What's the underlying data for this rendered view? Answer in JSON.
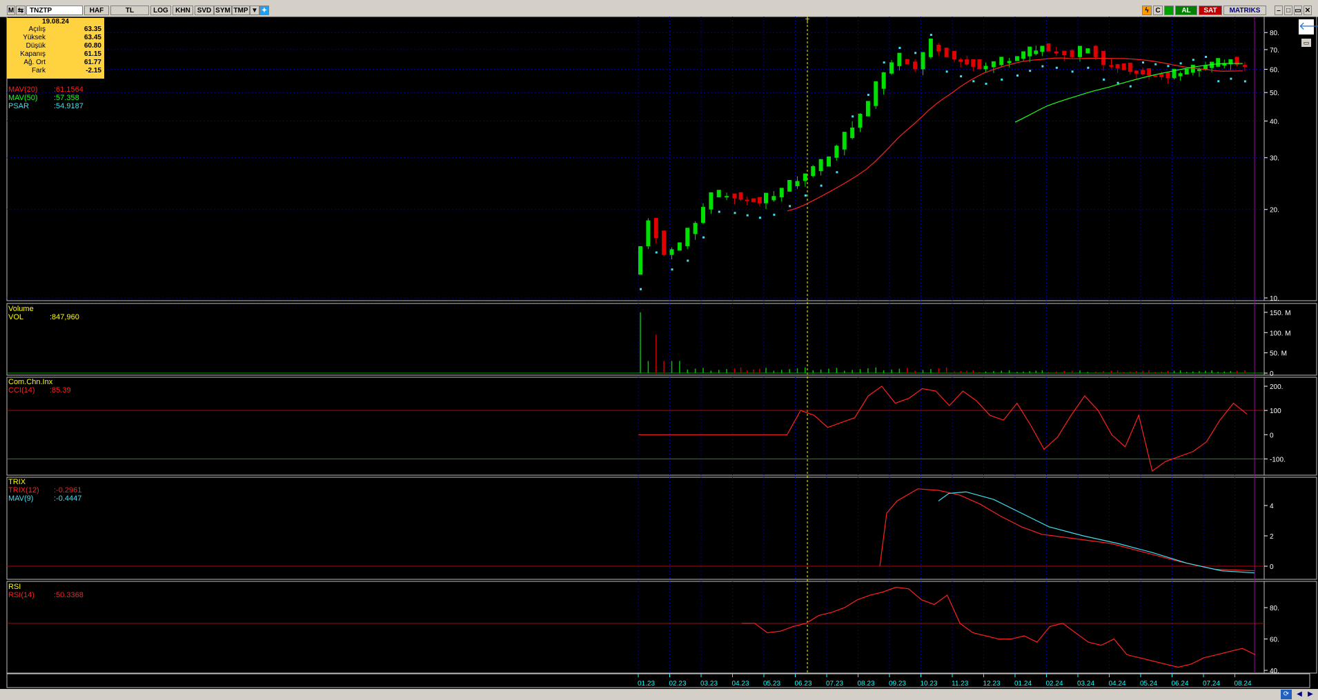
{
  "toolbar": {
    "symbol": "TNZTP",
    "buttons": [
      "HAF",
      "TL",
      "LOG",
      "KHN",
      "SVD",
      "SYM",
      "TMP"
    ],
    "buy_label": "AL",
    "sell_label": "SAT",
    "brand": "MATRIKS"
  },
  "info_box": {
    "date": "19.08.24",
    "rows": [
      {
        "label": "Açılış",
        "value": "63.35"
      },
      {
        "label": "Yüksek",
        "value": "63.45"
      },
      {
        "label": "Düşük",
        "value": "60.80"
      },
      {
        "label": "Kapanış",
        "value": "61.15"
      },
      {
        "label": "Ağ. Ort",
        "value": "61.77"
      },
      {
        "label": "Fark",
        "value": "-2.15"
      }
    ]
  },
  "price_panel": {
    "legend": [
      {
        "name": "MAV(20)",
        "value": ":61.1564",
        "color": "#ff2020"
      },
      {
        "name": "MAV(50)",
        "value": ":57.358",
        "color": "#20ff20"
      },
      {
        "name": "PSAR",
        "value": ":54.9187",
        "color": "#40e0f0"
      }
    ],
    "y_ticks": [
      "80.",
      "70.",
      "60.",
      "50.",
      "40.",
      "30.",
      "20.",
      "10."
    ]
  },
  "volume_panel": {
    "title": "Volume",
    "legend": [
      {
        "name": "VOL",
        "value": ":847,960",
        "color": "#ffff00"
      }
    ],
    "y_ticks": [
      "150. M",
      "100. M",
      "50. M",
      "0"
    ]
  },
  "cci_panel": {
    "title": "Com.Chn.Inx",
    "legend": [
      {
        "name": "CCI(14)",
        "value": ":85.39",
        "color": "#ff2020"
      }
    ],
    "y_ticks": [
      "200.",
      "100",
      "0",
      "-100."
    ]
  },
  "trix_panel": {
    "title": "TRIX",
    "legend": [
      {
        "name": "TRIX(12)",
        "value": ":-0.2961",
        "color": "#ff2020"
      },
      {
        "name": "MAV(9)",
        "value": ":-0.4447",
        "color": "#40e0f0"
      }
    ],
    "y_ticks": [
      "4",
      "2",
      "0"
    ]
  },
  "rsi_panel": {
    "title": "RSI",
    "legend": [
      {
        "name": "RSI(14)",
        "value": ":50.3368",
        "color": "#ff2020"
      }
    ],
    "y_ticks": [
      "80.",
      "60.",
      "40."
    ]
  },
  "x_axis": {
    "labels": [
      "01.23",
      "02.23",
      "03.23",
      "04.23",
      "05.23",
      "06.23",
      "07.23",
      "08.23",
      "09.23",
      "10.23",
      "11.23",
      "12.23",
      "01.24",
      "02.24",
      "03.24",
      "04.24",
      "05.24",
      "06.24",
      "07.24",
      "08.24"
    ]
  },
  "cursor_marker": "T",
  "colors": {
    "up": "#00e000",
    "down": "#e00000",
    "grid": "#0000a0",
    "axis_text": "#ffffff",
    "date_text": "#00ffff",
    "info_bg": "#ffd23f"
  },
  "chart_data": {
    "type": "line",
    "title": "TNZTP",
    "price": {
      "log_scale": true,
      "ylim": [
        10,
        85
      ],
      "mav20_last": 61.1564,
      "mav50_last": 57.358,
      "psar_last": 54.9187,
      "close_path": [
        [
          "01.23",
          12
        ],
        [
          "01.23",
          18
        ],
        [
          "02.23",
          14
        ],
        [
          "02.23",
          15
        ],
        [
          "03.23",
          18
        ],
        [
          "03.23",
          22
        ],
        [
          "04.23",
          22
        ],
        [
          "05.23",
          21
        ],
        [
          "05.23",
          22
        ],
        [
          "06.23",
          24
        ],
        [
          "06.23",
          26
        ],
        [
          "07.23",
          28
        ],
        [
          "07.23",
          32
        ],
        [
          "08.23",
          38
        ],
        [
          "08.23",
          45
        ],
        [
          "09.23",
          58
        ],
        [
          "09.23",
          65
        ],
        [
          "10.23",
          60
        ],
        [
          "10.23",
          72
        ],
        [
          "11.23",
          66
        ],
        [
          "12.23",
          60
        ],
        [
          "12.23",
          62
        ],
        [
          "01.24",
          64
        ],
        [
          "02.24",
          70
        ],
        [
          "02.24",
          68
        ],
        [
          "03.24",
          66
        ],
        [
          "03.24",
          70
        ],
        [
          "04.24",
          62
        ],
        [
          "05.24",
          58
        ],
        [
          "06.24",
          56
        ],
        [
          "07.24",
          60
        ],
        [
          "08.24",
          63
        ],
        [
          "08.24",
          61.15
        ]
      ]
    },
    "volume": {
      "last": 847960,
      "peak_month": "01.23",
      "peak_value": 150000000
    },
    "cci": {
      "last": 85.39,
      "ylim": [
        -150,
        220
      ]
    },
    "trix": {
      "last": -0.2961,
      "signal_last": -0.4447,
      "ylim": [
        -0.5,
        5.5
      ]
    },
    "rsi": {
      "last": 50.3368,
      "ylim": [
        40,
        95
      ]
    }
  }
}
